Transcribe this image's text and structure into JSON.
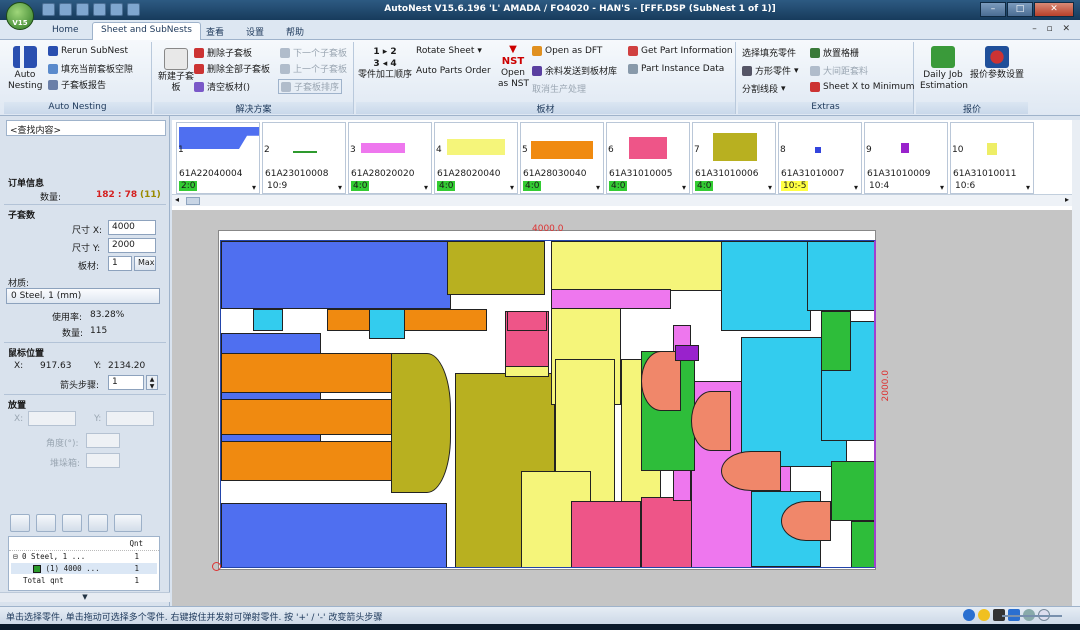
{
  "window": {
    "title": "AutoNest V15.6.196 'L' AMADA / FO4020     - HAN'S - [FFF.DSP (SubNest 1 of 1)]",
    "app_badge": "V15"
  },
  "tabs": [
    "Home",
    "Sheet and SubNests",
    "查看",
    "设置",
    "帮助"
  ],
  "ribbon": {
    "auto_nesting": {
      "big_label": "Auto\nNesting",
      "rerun": "Rerun SubNest",
      "fill": "填充当前套板空隙",
      "report": "子套板报告",
      "group": "Auto Nesting"
    },
    "solution": {
      "new": "新建子套板",
      "delete": "删除子套板",
      "delete_all": "删除全部子套板",
      "clear": "清空板材()",
      "next": "下一个子套板",
      "prev": "上一个子套板",
      "sort": "子套板排序",
      "group": "解决方案"
    },
    "sheet": {
      "order_label": "零件加工顺序",
      "rotate": "Rotate Sheet",
      "auto_order": "Auto Parts Order",
      "open_nst": "Open\nas NST",
      "open_dft": "Open as DFT",
      "send": "余料发送到板材库",
      "cancel": "取消生产处理",
      "group": "板材"
    },
    "partinfo": {
      "get": "Get Part Information",
      "instance": "Part Instance Data"
    },
    "extras": {
      "fill_parts": "选择填充零件",
      "square": "方形零件",
      "split": "分割线段",
      "grid": "放置格栅",
      "spacing": "大间距套料",
      "sheetx": "Sheet X to Minimum",
      "group": "Extras"
    },
    "quote": {
      "daily": "Daily Job\nEstimation",
      "params": "报价参数设置",
      "group": "报价"
    }
  },
  "left": {
    "search": "<查找内容>",
    "order_title": "订单信息",
    "qty_label": "数量:",
    "qty_value": "182 : 78",
    "qty_extra": "(11)",
    "subnest_title": "子套数",
    "size_x_label": "尺寸 X:",
    "size_x": "4000",
    "size_y_label": "尺寸 Y:",
    "size_y": "2000",
    "sheet_label": "板材:",
    "sheet_val": "1",
    "max": "Max",
    "material_label": "材质:",
    "material": "0 Steel, 1 (mm)",
    "util_label": "使用率:",
    "util": "83.28%",
    "count_label": "数量:",
    "count": "115",
    "mouse_title": "鼠标位置",
    "mx_label": "X:",
    "mx": "917.63",
    "my_label": "Y:",
    "my": "2134.20",
    "step_label": "箭头步骤:",
    "step": "1",
    "place_title": "放置",
    "px": "X:",
    "py": "Y:",
    "angle": "角度(°):",
    "stack": "堆垛箱:",
    "tree": {
      "qnt_header": "Qnt",
      "rows": [
        {
          "label": "0  Steel, 1 ...",
          "q": "1"
        },
        {
          "label": "(1) 4000 ...",
          "q": "1"
        },
        {
          "label": "Total qnt",
          "q": "1"
        }
      ]
    }
  },
  "parts_strip": [
    {
      "idx": "1",
      "name": "61A22040004",
      "qty": "2:0",
      "qty_color": "#33cc33",
      "color": "#4f6ff0"
    },
    {
      "idx": "2",
      "name": "61A23010008",
      "qty": "10:9",
      "qty_color": "#ffffff",
      "color": "#2e9a2e"
    },
    {
      "idx": "3",
      "name": "61A28020020",
      "qty": "4:0",
      "qty_color": "#33cc33",
      "color": "#ee77ee"
    },
    {
      "idx": "4",
      "name": "61A28020040",
      "qty": "4:0",
      "qty_color": "#33cc33",
      "color": "#f5f57a"
    },
    {
      "idx": "5",
      "name": "61A28030040",
      "qty": "4:0",
      "qty_color": "#33cc33",
      "color": "#f08a10"
    },
    {
      "idx": "6",
      "name": "61A31010005",
      "qty": "4:0",
      "qty_color": "#33cc33",
      "color": "#ee5588"
    },
    {
      "idx": "7",
      "name": "61A31010006",
      "qty": "4:0",
      "qty_color": "#33cc33",
      "color": "#b8b020"
    },
    {
      "idx": "8",
      "name": "61A31010007",
      "qty": "10:-5",
      "qty_color": "#ffff44",
      "color": "#3344dd"
    },
    {
      "idx": "9",
      "name": "61A31010009",
      "qty": "10:4",
      "qty_color": "#ffffff",
      "color": "#9922cc"
    },
    {
      "idx": "10",
      "name": "61A31010011",
      "qty": "10:6",
      "qty_color": "#ffffff",
      "color": "#eeee66"
    }
  ],
  "canvas": {
    "dim_x": "4000.0",
    "dim_y": "2000.0"
  },
  "status": {
    "message": "单击选择零件, 单击拖动可选择多个零件. 右键按住并发射可弹射零件. 按 '+' / '-' 改变箭头步骤"
  }
}
